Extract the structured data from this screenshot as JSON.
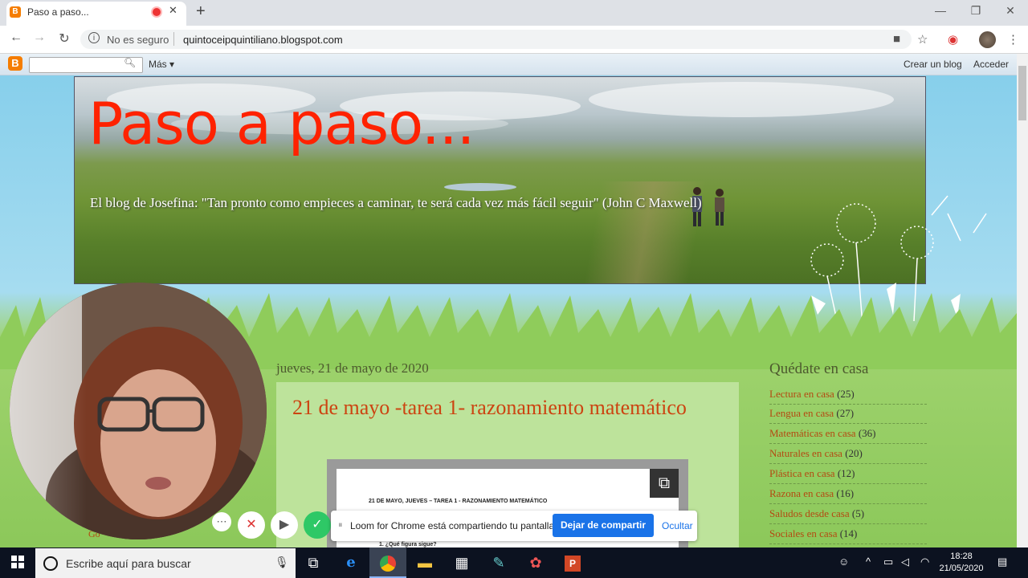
{
  "browser": {
    "tab_title": "Paso a paso...",
    "favicon_letter": "B",
    "new_tab_symbol": "+",
    "security": "No es seguro",
    "url": "quintoceipquintiliano.blogspot.com"
  },
  "blogger_nav": {
    "logo_letter": "B",
    "more_label": "Más ▾",
    "create_blog": "Crear un blog",
    "sign_in": "Acceder"
  },
  "blog": {
    "title": "Paso a paso...",
    "description": "El blog de Josefina: \"Tan pronto como empieces a caminar, te será cada vez más fácil seguir\" (John C Maxwell)"
  },
  "post": {
    "date": "jueves, 21 de mayo de 2020",
    "title": "21 de mayo -tarea 1- razonamiento matemático",
    "doc_heading": "21 DE MAYO, JUEVES – TAREA 1 - RAZONAMIENTO MATEMÁTICO",
    "doc_question": "1.   ¿Qué figura sigue?"
  },
  "sidebar": {
    "title": "Quédate en casa",
    "items": [
      {
        "label": "Lectura en casa",
        "count": "(25)"
      },
      {
        "label": "Lengua en casa",
        "count": "(27)"
      },
      {
        "label": "Matemáticas en casa",
        "count": "(36)"
      },
      {
        "label": "Naturales en casa",
        "count": "(20)"
      },
      {
        "label": "Plástica en casa",
        "count": "(12)"
      },
      {
        "label": "Razona en casa",
        "count": "(16)"
      },
      {
        "label": "Saludos desde casa",
        "count": "(5)"
      },
      {
        "label": "Sociales en casa",
        "count": "(14)"
      }
    ]
  },
  "left_partial": "Go",
  "loom": {
    "message": "Loom for Chrome está compartiendo tu pantalla.",
    "stop_label": "Dejar de compartir",
    "hide_label": "Ocultar"
  },
  "taskbar": {
    "search_placeholder": "Escribe aquí para buscar",
    "time": "18:28",
    "date": "21/05/2020"
  },
  "colors": {
    "blog_title": "#ff2200",
    "post_title": "#cc4411",
    "link": "#b44a12",
    "loom_blue": "#1a73e8",
    "taskbar": "#0c1220"
  }
}
